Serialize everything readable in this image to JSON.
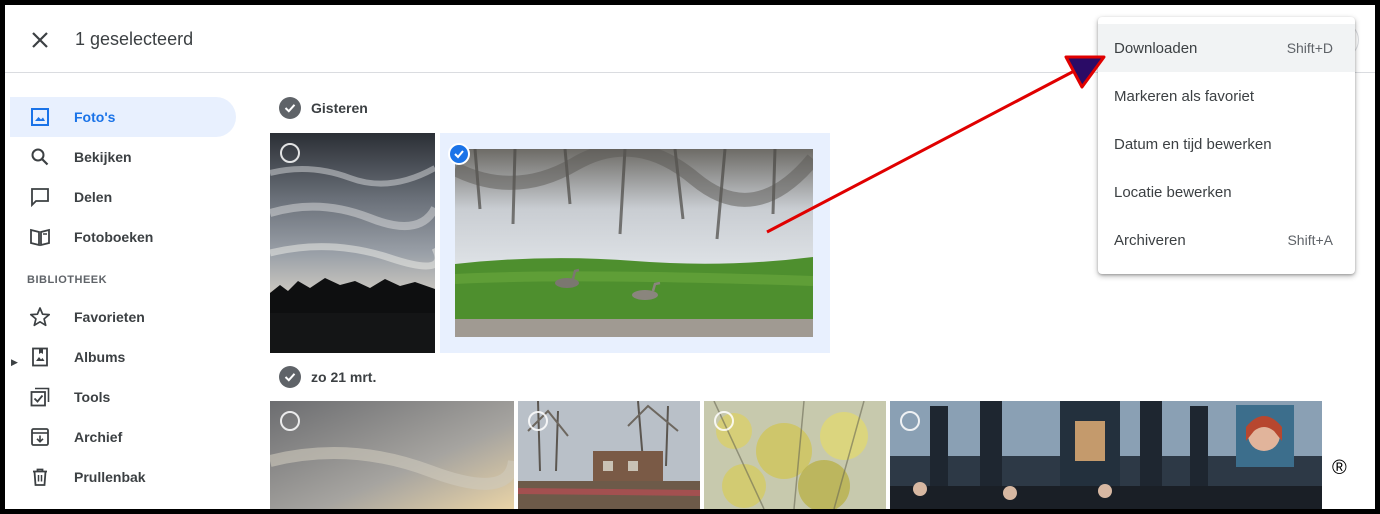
{
  "header": {
    "selected_text": "1 geselecteerd",
    "close_icon": "close-icon"
  },
  "sidebar": {
    "items": [
      {
        "label": "Foto's",
        "icon": "photo-icon",
        "active": true
      },
      {
        "label": "Bekijken",
        "icon": "search-icon"
      },
      {
        "label": "Delen",
        "icon": "chat-icon"
      },
      {
        "label": "Fotoboeken",
        "icon": "book-icon"
      },
      {
        "label": "Favorieten",
        "icon": "star-icon"
      },
      {
        "label": "Albums",
        "icon": "album-icon"
      },
      {
        "label": "Tools",
        "icon": "checklist-icon"
      },
      {
        "label": "Archief",
        "icon": "archive-icon"
      },
      {
        "label": "Prullenbak",
        "icon": "trash-icon"
      }
    ],
    "section_label": "BIBLIOTHEEK"
  },
  "groups": [
    {
      "date": "Gisteren"
    },
    {
      "date": "zo 21 mrt."
    }
  ],
  "menu": {
    "items": [
      {
        "label": "Downloaden",
        "shortcut": "Shift+D"
      },
      {
        "label": "Markeren als favoriet",
        "shortcut": ""
      },
      {
        "label": "Datum en tijd bewerken",
        "shortcut": ""
      },
      {
        "label": "Locatie bewerken",
        "shortcut": ""
      },
      {
        "label": "Archiveren",
        "shortcut": "Shift+A"
      }
    ]
  },
  "watermark": "®",
  "colors": {
    "accent": "#1a73e8",
    "arrow": "#e00000",
    "active_bg": "#e8f0fe"
  }
}
